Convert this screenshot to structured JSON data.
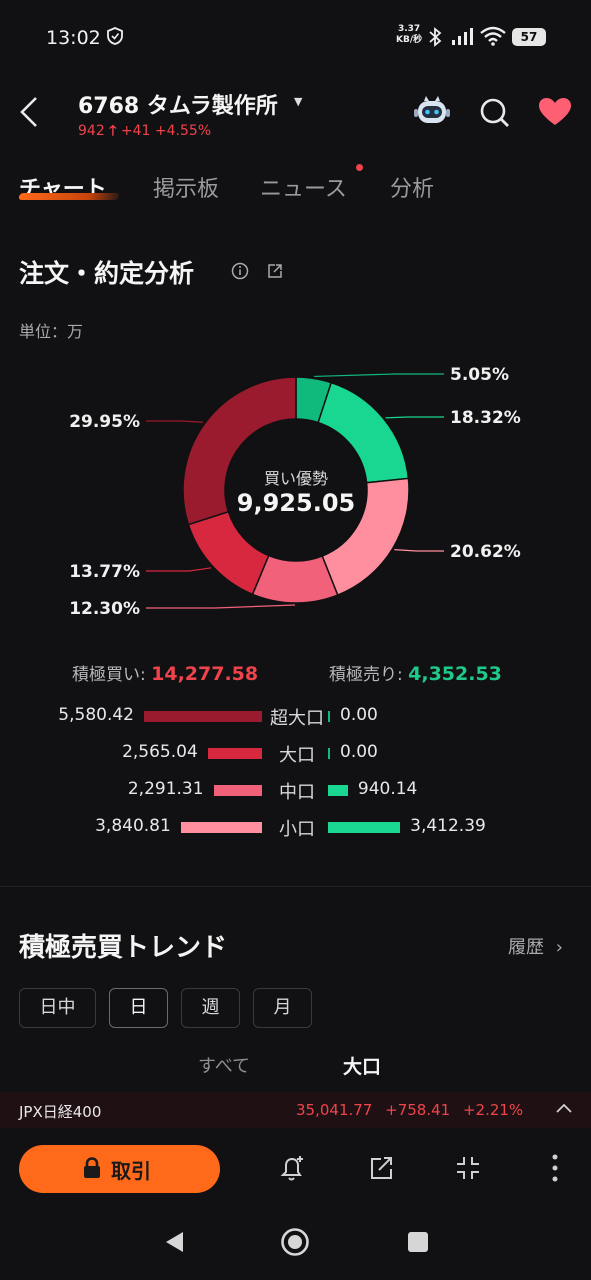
{
  "status_bar": {
    "time": "13:02",
    "net_speed_value": "3.37",
    "net_speed_unit": "KB/秒",
    "battery": "57"
  },
  "header": {
    "title": "6768  タムラ製作所",
    "price": "942",
    "change": "+41",
    "change_pct": "+4.55%"
  },
  "tabs": [
    {
      "label": "チャート",
      "active": true
    },
    {
      "label": "掲示板",
      "active": false
    },
    {
      "label": "ニュース",
      "active": false,
      "badge": true
    },
    {
      "label": "分析",
      "active": false
    }
  ],
  "analysis": {
    "title": "注文・約定分析",
    "unit": "単位：万",
    "center_label": "買い優勢",
    "center_value": "9,925.05",
    "summary": {
      "buy_label": "積極買い: ",
      "buy_value": "14,277.58",
      "sell_label": "積極売り: ",
      "sell_value": "4,352.53"
    },
    "rows": [
      {
        "category": "超大口",
        "buy": "5,580.42",
        "sell": "0.00"
      },
      {
        "category": "大口",
        "buy": "2,565.04",
        "sell": "0.00"
      },
      {
        "category": "中口",
        "buy": "2,291.31",
        "sell": "940.14"
      },
      {
        "category": "小口",
        "buy": "3,840.81",
        "sell": "3,412.39"
      }
    ]
  },
  "chart_data": {
    "type": "pie",
    "style": "donut",
    "slices": [
      {
        "label": "5.05%",
        "value": 5.05,
        "color": "#10b97c"
      },
      {
        "label": "18.32%",
        "value": 18.32,
        "color": "#19d690"
      },
      {
        "label": "20.62%",
        "value": 20.62,
        "color": "#ff8f9e"
      },
      {
        "label": "12.30%",
        "value": 12.3,
        "color": "#f2617a"
      },
      {
        "label": "13.77%",
        "value": 13.77,
        "color": "#d8283f"
      },
      {
        "label": "29.95%",
        "value": 29.95,
        "color": "#9a1b2d"
      }
    ]
  },
  "trend": {
    "title": "積極売買トレンド",
    "history": "履歴",
    "periods": [
      "日中",
      "日",
      "週",
      "月"
    ],
    "active_period": "日",
    "segments": [
      "すべて",
      "大口"
    ]
  },
  "index_ticker": {
    "name": "JPX日経400",
    "value": "35,041.77",
    "change": "+758.41",
    "change_pct": "+2.21%"
  },
  "toolbar": {
    "trade_label": "取引"
  },
  "colors": {
    "accent": "#ff6a1a",
    "up": "#f0434b",
    "down": "#1fc98a",
    "bg": "#111113"
  }
}
